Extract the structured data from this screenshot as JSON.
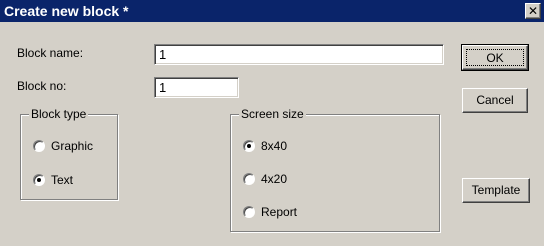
{
  "window": {
    "title": "Create new block *",
    "close_glyph": "✕"
  },
  "form": {
    "block_name_label": "Block name:",
    "block_name_value": "1",
    "block_no_label": "Block no:",
    "block_no_value": "1"
  },
  "block_type": {
    "title": "Block type",
    "options": [
      {
        "label": "Graphic",
        "checked": false
      },
      {
        "label": "Text",
        "checked": true
      }
    ]
  },
  "screen_size": {
    "title": "Screen size",
    "options": [
      {
        "label": "8x40",
        "checked": true
      },
      {
        "label": "4x20",
        "checked": false
      },
      {
        "label": "Report",
        "checked": false
      }
    ]
  },
  "buttons": {
    "ok": "OK",
    "cancel": "Cancel",
    "template": "Template"
  }
}
